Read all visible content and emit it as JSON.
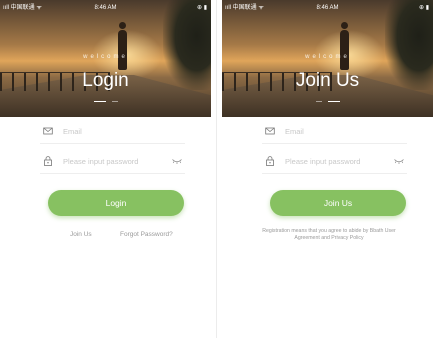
{
  "status_bar": {
    "carrier": "ııll 中国联通 ᯤ",
    "time": "8:46 AM",
    "icons": "⊕ ▮"
  },
  "hero": {
    "welcome": "welcome"
  },
  "login": {
    "title": "Login",
    "email_placeholder": "Email",
    "password_placeholder": "Please input password",
    "button": "Login",
    "join_link": "Join Us",
    "forgot_link": "Forgot Password?"
  },
  "join": {
    "title": "Join Us",
    "email_placeholder": "Email",
    "password_placeholder": "Please input password",
    "button": "Join Us",
    "policy": "Registration means that you agree to abide by Bbath User Agreement and Privacy Policy"
  },
  "colors": {
    "accent": "#87c161"
  },
  "icons": [
    "mail-icon",
    "lock-icon",
    "eye-icon"
  ]
}
